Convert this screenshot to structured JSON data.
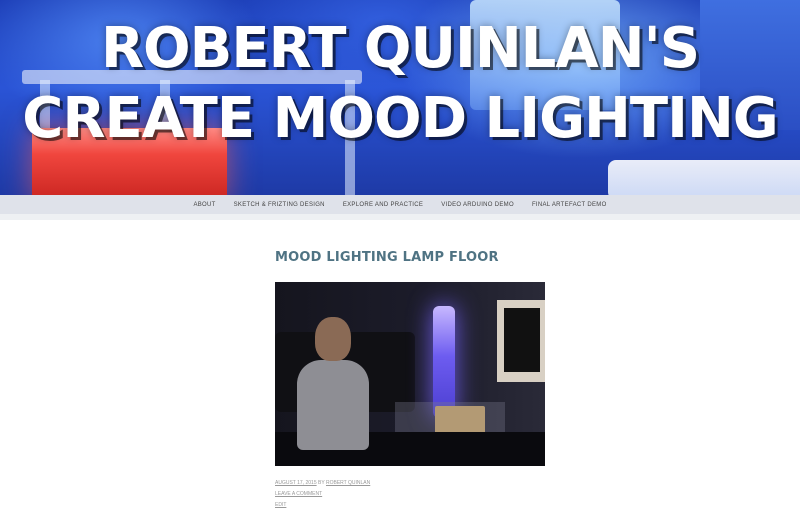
{
  "site": {
    "title": "ROBERT QUINLAN'S CREATE MOOD LIGHTING"
  },
  "nav": {
    "items": [
      "ABOUT",
      "SKETCH & FRIZTING DESIGN",
      "EXPLORE AND PRACTICE",
      "VIDEO ARDUINO DEMO",
      "FINAL ARTEFACT DEMO"
    ]
  },
  "post": {
    "title": "MOOD LIGHTING LAMP FLOOR",
    "date": "AUGUST 17, 2015",
    "by": "BY",
    "author": "ROBERT QUINLAN",
    "comment_link": "LEAVE A COMMENT",
    "edit_link": "EDIT"
  },
  "colors": {
    "banner_blue": "#2a54d6",
    "post_title": "#4f7383",
    "lamp_glow": "#6d5cf0",
    "cube_red": "#f0463e"
  }
}
